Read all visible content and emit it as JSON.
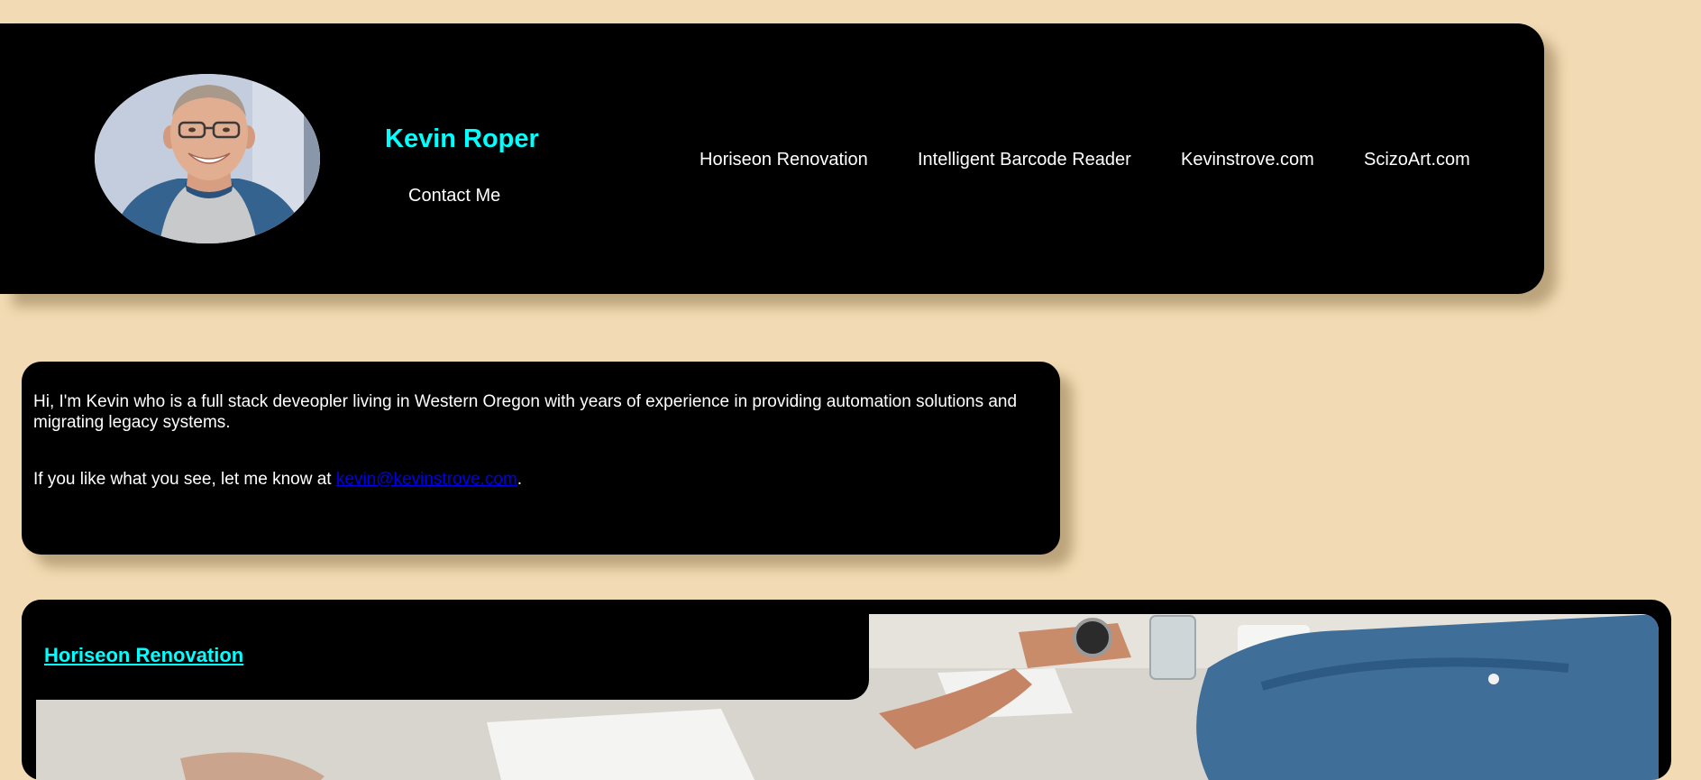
{
  "header": {
    "name": "Kevin Roper",
    "contact_label": "Contact Me",
    "nav": [
      "Horiseon Renovation",
      "Intelligent Barcode Reader",
      "Kevinstrove.com",
      "ScizoArt.com"
    ]
  },
  "about": {
    "intro": "Hi, I'm Kevin who is a full stack deveopler living in Western Oregon with years of experience in providing automation solutions and migrating legacy systems.",
    "cta_prefix": "If you like what you see, let me know at ",
    "email": "kevin@kevinstrove.com",
    "cta_suffix": "."
  },
  "projects": [
    {
      "title": "Horiseon Renovation"
    }
  ],
  "colors": {
    "page_background": "#f2dbb4",
    "panel": "#000000",
    "accent": "#00ffff",
    "link": "#0000ee",
    "text": "#ffffff"
  },
  "icons": {
    "avatar": "portrait-photo"
  }
}
